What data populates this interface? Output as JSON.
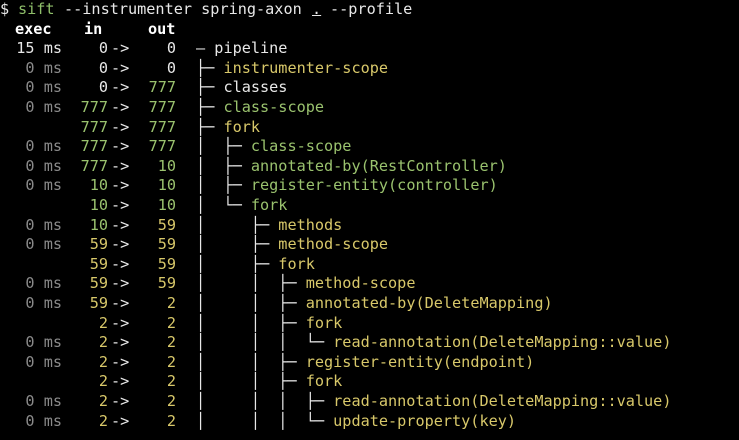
{
  "colors": {
    "background": "#000000",
    "prompt": "#e8e8e8",
    "command": "#8fbf6a",
    "ms_dim": "#8a8a8a",
    "ms_bright": "#e8e8e8",
    "num_green": "#9ac26e",
    "num_white": "#e8e8e8",
    "label_green": "#9ac26e",
    "label_yellow": "#d8c86a",
    "tree": "#e8e8e8"
  },
  "prompt": {
    "symbol": "$",
    "command": "sift",
    "args": "--instrumenter spring-axon",
    "dot": ".",
    "profile_flag": "--profile"
  },
  "headers": {
    "exec": "exec",
    "in": "in",
    "out": "out"
  },
  "arrow": "->",
  "rows": [
    {
      "exec": "15 ms",
      "exec_style": "bright",
      "in": "0",
      "in_style": "white",
      "out": "0",
      "out_style": "white",
      "tree": "—",
      "label": "pipeline",
      "label_style": "white"
    },
    {
      "exec": "0 ms",
      "exec_style": "dim",
      "in": "0",
      "in_style": "white",
      "out": "0",
      "out_style": "white",
      "tree": "├─",
      "label": "instrumenter-scope",
      "label_style": "yellow"
    },
    {
      "exec": "0 ms",
      "exec_style": "dim",
      "in": "0",
      "in_style": "white",
      "out": "777",
      "out_style": "green",
      "tree": "├─",
      "label": "classes",
      "label_style": "white"
    },
    {
      "exec": "0 ms",
      "exec_style": "dim",
      "in": "777",
      "in_style": "green",
      "out": "777",
      "out_style": "green",
      "tree": "├─",
      "label": "class-scope",
      "label_style": "green"
    },
    {
      "exec": "",
      "exec_style": "dim",
      "in": "777",
      "in_style": "green",
      "out": "777",
      "out_style": "green",
      "tree": "├─",
      "label": "fork",
      "label_style": "yellow"
    },
    {
      "exec": "0 ms",
      "exec_style": "dim",
      "in": "777",
      "in_style": "green",
      "out": "777",
      "out_style": "green",
      "tree": "│  ├─",
      "label": "class-scope",
      "label_style": "green"
    },
    {
      "exec": "0 ms",
      "exec_style": "dim",
      "in": "777",
      "in_style": "green",
      "out": "10",
      "out_style": "green",
      "tree": "│  ├─",
      "label": "annotated-by(RestController)",
      "label_style": "green"
    },
    {
      "exec": "0 ms",
      "exec_style": "dim",
      "in": "10",
      "in_style": "green",
      "out": "10",
      "out_style": "green",
      "tree": "│  ├─",
      "label": "register-entity(controller)",
      "label_style": "green"
    },
    {
      "exec": "",
      "exec_style": "dim",
      "in": "10",
      "in_style": "green",
      "out": "10",
      "out_style": "green",
      "tree": "│  └─",
      "label": "fork",
      "label_style": "green"
    },
    {
      "exec": "0 ms",
      "exec_style": "dim",
      "in": "10",
      "in_style": "green",
      "out": "59",
      "out_style": "yellow",
      "tree": "│     ├─",
      "label": "methods",
      "label_style": "yellow"
    },
    {
      "exec": "0 ms",
      "exec_style": "dim",
      "in": "59",
      "in_style": "yellow",
      "out": "59",
      "out_style": "yellow",
      "tree": "│     ├─",
      "label": "method-scope",
      "label_style": "yellow"
    },
    {
      "exec": "",
      "exec_style": "dim",
      "in": "59",
      "in_style": "yellow",
      "out": "59",
      "out_style": "yellow",
      "tree": "│     ├─",
      "label": "fork",
      "label_style": "yellow"
    },
    {
      "exec": "0 ms",
      "exec_style": "dim",
      "in": "59",
      "in_style": "yellow",
      "out": "59",
      "out_style": "yellow",
      "tree": "│     │  ├─",
      "label": "method-scope",
      "label_style": "yellow"
    },
    {
      "exec": "0 ms",
      "exec_style": "dim",
      "in": "59",
      "in_style": "yellow",
      "out": "2",
      "out_style": "yellow",
      "tree": "│     │  ├─",
      "label": "annotated-by(DeleteMapping)",
      "label_style": "yellow"
    },
    {
      "exec": "",
      "exec_style": "dim",
      "in": "2",
      "in_style": "yellow",
      "out": "2",
      "out_style": "yellow",
      "tree": "│     │  ├─",
      "label": "fork",
      "label_style": "yellow"
    },
    {
      "exec": "0 ms",
      "exec_style": "dim",
      "in": "2",
      "in_style": "yellow",
      "out": "2",
      "out_style": "yellow",
      "tree": "│     │  │  └─",
      "label": "read-annotation(DeleteMapping::value)",
      "label_style": "yellow"
    },
    {
      "exec": "0 ms",
      "exec_style": "dim",
      "in": "2",
      "in_style": "yellow",
      "out": "2",
      "out_style": "yellow",
      "tree": "│     │  ├─",
      "label": "register-entity(endpoint)",
      "label_style": "yellow"
    },
    {
      "exec": "",
      "exec_style": "dim",
      "in": "2",
      "in_style": "yellow",
      "out": "2",
      "out_style": "yellow",
      "tree": "│     │  ├─",
      "label": "fork",
      "label_style": "yellow"
    },
    {
      "exec": "0 ms",
      "exec_style": "dim",
      "in": "2",
      "in_style": "yellow",
      "out": "2",
      "out_style": "yellow",
      "tree": "│     │  │  ├─",
      "label": "read-annotation(DeleteMapping::value)",
      "label_style": "yellow"
    },
    {
      "exec": "0 ms",
      "exec_style": "dim",
      "in": "2",
      "in_style": "yellow",
      "out": "2",
      "out_style": "yellow",
      "tree": "│     │  │  └─",
      "label": "update-property(key)",
      "label_style": "yellow"
    }
  ]
}
